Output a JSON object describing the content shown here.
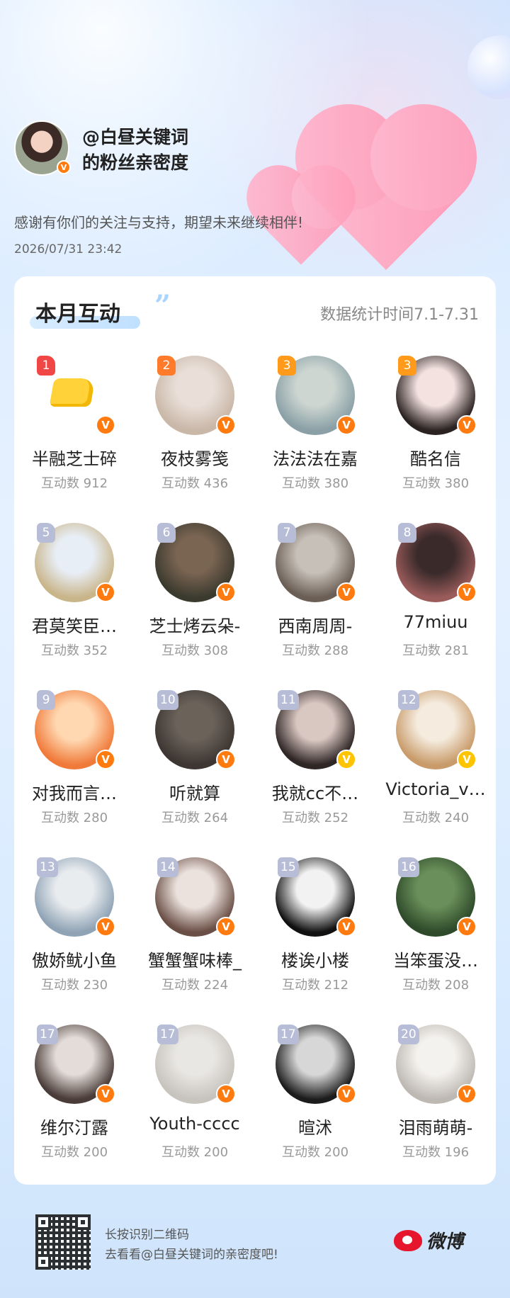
{
  "header": {
    "name_line1": "@白昼关键词",
    "name_line2": "的粉丝亲密度",
    "thanks": "感谢有你们的关注与支持，期望未来继续相伴!",
    "datetime": "2026/07/31  23:42"
  },
  "card": {
    "title": "本月互动",
    "stat_range": "数据统计时间7.1-7.31"
  },
  "verified_icon": "V",
  "fans": [
    {
      "rank": "1",
      "name": "半融芝士碎",
      "count": "互动数 912",
      "avatar": "cheese"
    },
    {
      "rank": "2",
      "name": "夜枝雾笺",
      "count": "互动数 436"
    },
    {
      "rank": "3",
      "name": "法法法在嘉",
      "count": "互动数 380"
    },
    {
      "rank": "3",
      "name": "酷名信",
      "count": "互动数 380"
    },
    {
      "rank": "5",
      "name": "君莫笑臣…",
      "count": "互动数 352"
    },
    {
      "rank": "6",
      "name": "芝士烤云朵-",
      "count": "互动数 308"
    },
    {
      "rank": "7",
      "name": "西南周周-",
      "count": "互动数 288"
    },
    {
      "rank": "8",
      "name": "77miuu",
      "count": "互动数 281"
    },
    {
      "rank": "9",
      "name": "对我而言…",
      "count": "互动数 280"
    },
    {
      "rank": "10",
      "name": "听就算",
      "count": "互动数 264"
    },
    {
      "rank": "11",
      "name": "我就cc不…",
      "count": "互动数 252",
      "badge": "gold"
    },
    {
      "rank": "12",
      "name": "Victoria_v…",
      "count": "互动数 240",
      "badge": "gold"
    },
    {
      "rank": "13",
      "name": "傲娇鱿小鱼",
      "count": "互动数 230"
    },
    {
      "rank": "14",
      "name": "蟹蟹蟹味棒_",
      "count": "互动数 224"
    },
    {
      "rank": "15",
      "name": "楼诶小楼",
      "count": "互动数 212"
    },
    {
      "rank": "16",
      "name": "当笨蛋没…",
      "count": "互动数 208"
    },
    {
      "rank": "17",
      "name": "维尔汀露",
      "count": "互动数 200"
    },
    {
      "rank": "17",
      "name": "Youth-cccc",
      "count": "互动数 200"
    },
    {
      "rank": "17",
      "name": "暄沭",
      "count": "互动数 200"
    },
    {
      "rank": "20",
      "name": "泪雨萌萌-",
      "count": "互动数 196"
    }
  ],
  "footer": {
    "line1": "长按识别二维码",
    "line2": "去看看@白昼关键词的亲密度吧!",
    "brand": "微博"
  },
  "colors": {
    "rank1": "#f04646",
    "rank2": "#ff7a2b",
    "rank3": "#ff9a1a",
    "rank_other": "#b7bdd6",
    "verified_orange": "#ff7a0f",
    "verified_gold": "#ffc400",
    "weibo_red": "#e6162d"
  }
}
